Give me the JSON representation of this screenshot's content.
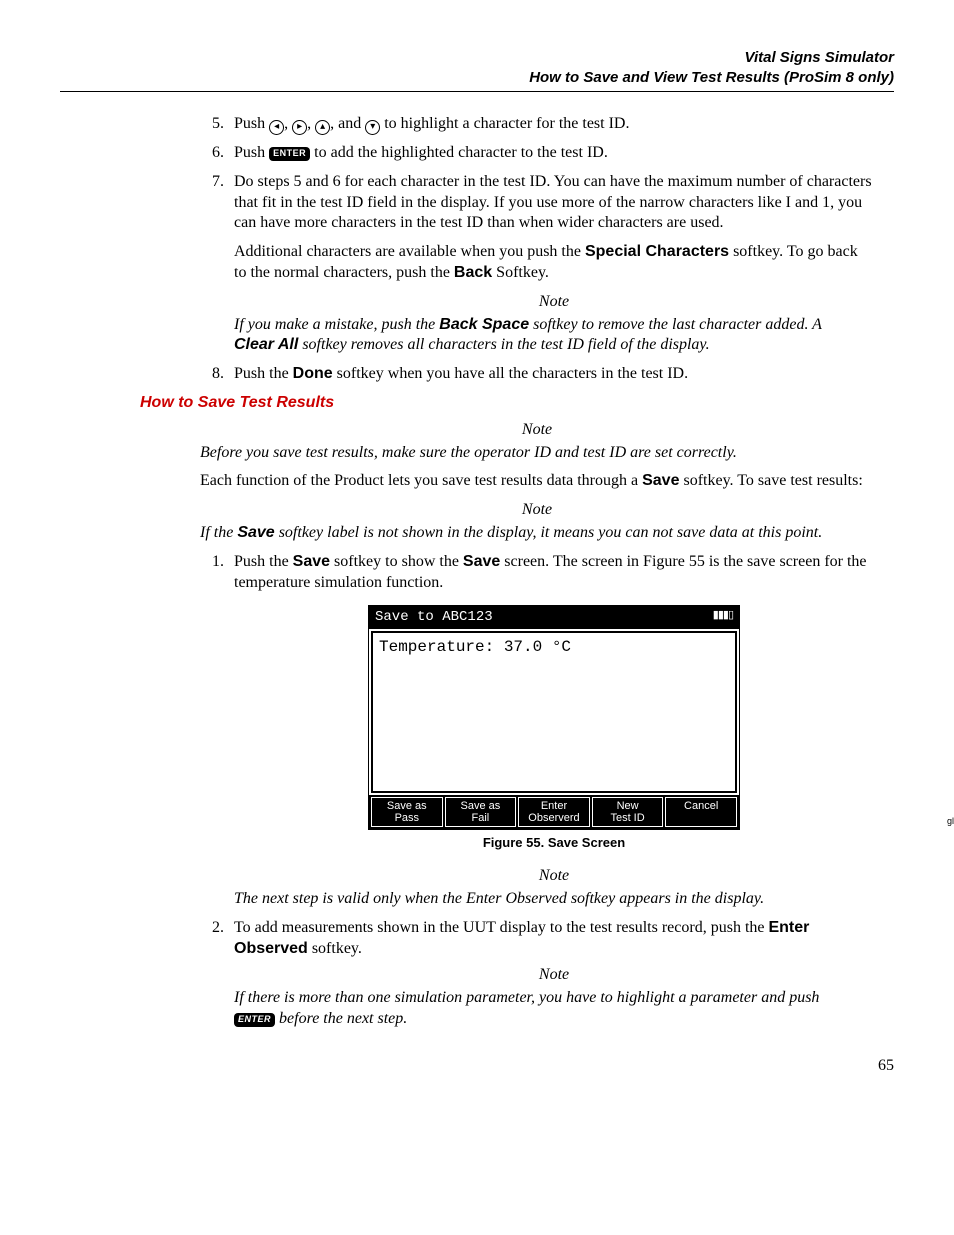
{
  "header": {
    "title": "Vital Signs Simulator",
    "subtitle": "How to Save and View Test Results (ProSim 8 only)"
  },
  "steps_a": {
    "s5_a": "Push ",
    "s5_b": ", and ",
    "s5_c": " to highlight a character for the test ID.",
    "s6_a": "Push ",
    "s6_enter": "ENTER",
    "s6_b": " to add the highlighted character to the test ID.",
    "s7_p1": "Do steps 5 and 6 for each character in the test ID. You can have the maximum number of characters that fit in the test ID field in the display. If you use more of the narrow characters like I and 1, you can have more characters in the test ID than when wider characters are used.",
    "s7_p2_a": "Additional characters are available when you push the ",
    "s7_p2_sc": "Special Characters",
    "s7_p2_b": " softkey. To go back to the normal characters, push the ",
    "s7_p2_back": "Back",
    "s7_p2_c": " Softkey.",
    "note1_label": "Note",
    "note1_a": "If you make a mistake, push the ",
    "note1_bs": "Back Space",
    "note1_b": " softkey to remove the last character added. A ",
    "note1_ca": "Clear All",
    "note1_c": " softkey removes all characters in the test ID field of the display.",
    "s8_a": "Push the ",
    "s8_done": "Done",
    "s8_b": " softkey when you have all the characters in the test ID."
  },
  "section_title": "How to Save Test Results",
  "save": {
    "note2_label": "Note",
    "note2": "Before you save test results, make sure the operator ID and test ID are set correctly.",
    "para_a": "Each function of the Product lets you save test results data through a ",
    "para_save": "Save",
    "para_b": " softkey. To save test results:",
    "note3_label": "Note",
    "note3_a": "If the ",
    "note3_save": "Save",
    "note3_b": " softkey label is not shown in the display, it means you can not save data at this point.",
    "s1_a": "Push the ",
    "s1_save1": "Save",
    "s1_b": " softkey to show the ",
    "s1_save2": "Save",
    "s1_c": " screen. The screen in Figure 55 is the save screen for the temperature simulation function."
  },
  "screen": {
    "title": "Save to ABC123",
    "body": "Temperature: 37.0 °C",
    "softkeys": [
      "Save as\nPass",
      "Save as\nFail",
      "Enter\nObserverd",
      "New\nTest ID",
      "Cancel"
    ],
    "img_id": "glh039.bmp",
    "caption": "Figure 55. Save Screen"
  },
  "after": {
    "note4_label": "Note",
    "note4": "The next step is valid only when the Enter Observed softkey appears in the display.",
    "s2_a": "To add measurements shown in the UUT display to the test results record, push the ",
    "s2_eo": "Enter Observed",
    "s2_b": " softkey.",
    "note5_label": "Note",
    "note5_a": "If there is more than one simulation parameter, you have to highlight a parameter and push ",
    "note5_enter": "ENTER",
    "note5_b": " before the next step."
  },
  "page_number": "65"
}
